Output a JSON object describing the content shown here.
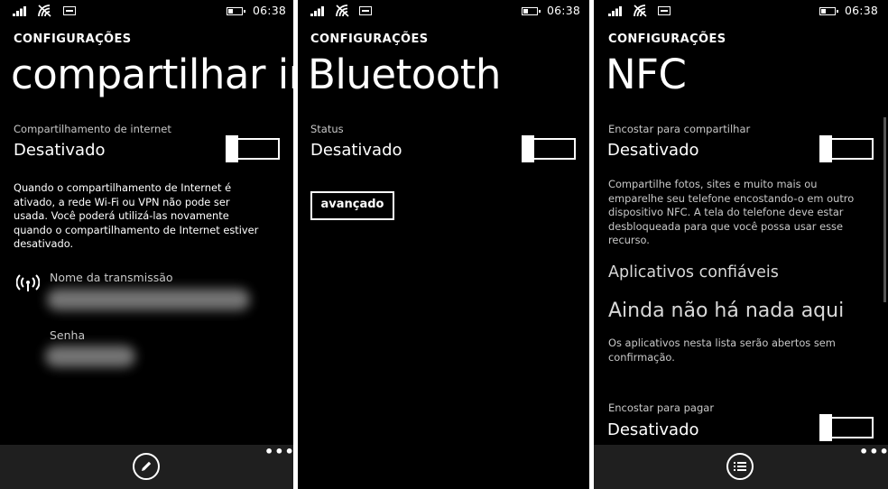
{
  "status": {
    "time": "06:38"
  },
  "screens": [
    {
      "app_title": "CONFIGURAÇÕES",
      "page_title": "compartilhar in",
      "setting": {
        "label": "Compartilhamento de internet",
        "value": "Desativado"
      },
      "description": [
        "Quando o compartilhamento de Internet é",
        "ativado, a rede Wi-Fi ou VPN não pode ser",
        "usada. Você poderá utilizá-las novamente",
        "quando o compartilhamento de Internet estiver",
        "desativado."
      ],
      "broadcast_name_label": "Nome da transmissão",
      "password_label": "Senha",
      "appbar": {
        "more": "•••"
      }
    },
    {
      "app_title": "CONFIGURAÇÕES",
      "page_title": "Bluetooth",
      "setting": {
        "label": "Status",
        "value": "Desativado"
      },
      "advanced_button": "avançado"
    },
    {
      "app_title": "CONFIGURAÇÕES",
      "page_title": "NFC",
      "setting": {
        "label": "Encostar para compartilhar",
        "value": "Desativado"
      },
      "description": [
        "Compartilhe fotos, sites e muito mais ou",
        "emparelhe seu telefone encostando-o em outro",
        "dispositivo NFC. A tela do telefone deve estar",
        "desbloqueada para que você possa usar esse",
        "recurso."
      ],
      "trusted_apps_header": "Aplicativos confiáveis",
      "empty_message": "Ainda não há nada aqui",
      "trusted_note": [
        "Os aplicativos nesta lista serão abertos sem",
        "confirmação."
      ],
      "pay_setting": {
        "label": "Encostar para pagar",
        "value": "Desativado"
      },
      "appbar": {
        "more": "•••"
      }
    }
  ]
}
